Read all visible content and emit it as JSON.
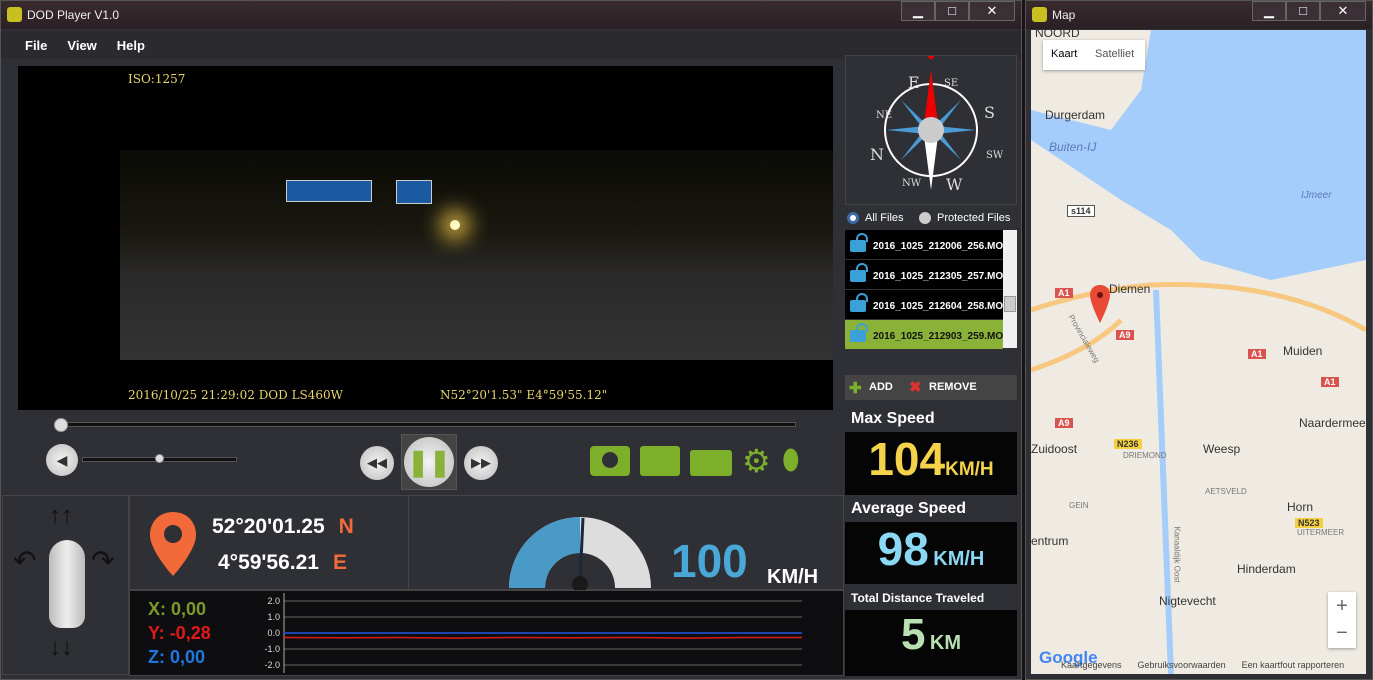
{
  "player": {
    "title": "DOD Player V1.0",
    "menu": [
      "File",
      "View",
      "Help"
    ],
    "video": {
      "iso": "ISO:1257",
      "timestamp": "2016/10/25 21:29:02 DOD LS460W",
      "gps_overlay": "N52°20'1.53\" E4°59'55.12\""
    },
    "progress": 0.01,
    "volume": 0.5,
    "gps": {
      "lat": "52°20'01.25",
      "lat_dir": "N",
      "lon": "4°59'56.21",
      "lon_dir": "E"
    },
    "speed": {
      "value": "100",
      "unit": "KM/H",
      "gauge_fraction": 0.5
    },
    "accel": {
      "x_label": "X:",
      "x": "0,00",
      "y_label": "Y:",
      "y": "-0,28",
      "z_label": "Z:",
      "z": "0,00"
    },
    "compass": {
      "labels": [
        "N",
        "NE",
        "E",
        "SE",
        "S",
        "SW",
        "W",
        "NW"
      ]
    },
    "files": {
      "filter_all": "All Files",
      "filter_protected": "Protected Files",
      "items": [
        "2016_1025_212006_256.MOV",
        "2016_1025_212305_257.MOV",
        "2016_1025_212604_258.MOV",
        "2016_1025_212903_259.MOV"
      ],
      "add": "ADD",
      "remove": "REMOVE"
    },
    "stats": {
      "max_label": "Max Speed",
      "max_value": "104",
      "max_unit": "KM/H",
      "avg_label": "Average Speed",
      "avg_value": "98",
      "avg_unit": "KM/H",
      "dist_label": "Total Distance Traveled",
      "dist_value": "5",
      "dist_unit": "KM"
    },
    "colors": {
      "x": "#7a9a2a",
      "y": "#e01818",
      "z": "#1e78e0",
      "accent": "#f26a3a",
      "green": "#8ab238"
    }
  },
  "map": {
    "title": "Map",
    "tabs": [
      "Kaart",
      "Satelliet"
    ],
    "labels": [
      "NOORD",
      "Durgerdam",
      "Buiten-IJ",
      "IJmeer",
      "Diemen",
      "Muiden",
      "Naardermee",
      "Zuidoost",
      "DRIEMOND",
      "Weesp",
      "AETSVELD",
      "GEIN",
      "Horn",
      "UITERMEER",
      "Hinderdam",
      "Nigtevecht",
      "Provincialeweg",
      "Kanaaldijk Oost",
      "entrum"
    ],
    "roads": [
      "s114",
      "A1",
      "A1",
      "A1",
      "A9",
      "A9",
      "N236",
      "N523"
    ],
    "footer": [
      "Kaartgegevens",
      "Gebruiksvoorwaarden",
      "Een kaartfout rapporteren"
    ],
    "zoom_in": "+",
    "zoom_out": "−",
    "logo": "Google"
  },
  "chart_data": {
    "type": "line",
    "title": "",
    "xlabel": "",
    "ylabel": "",
    "ylim": [
      -2,
      2
    ],
    "yticks": [
      "2.0",
      "1.0",
      "0.0",
      "-1.0",
      "-2.0"
    ],
    "series": [
      {
        "name": "X",
        "color": "#2a9a2a",
        "values": [
          0,
          0,
          0,
          0,
          0,
          0,
          0,
          0,
          0,
          0
        ]
      },
      {
        "name": "Y",
        "color": "#e01818",
        "values": [
          -0.28,
          -0.3,
          -0.28,
          -0.32,
          -0.28,
          -0.3,
          -0.28,
          -0.32,
          -0.28,
          -0.28
        ]
      },
      {
        "name": "Z",
        "color": "#1e3ce0",
        "values": [
          0,
          0,
          0,
          0,
          0,
          0,
          0,
          0,
          0,
          0
        ]
      }
    ]
  }
}
